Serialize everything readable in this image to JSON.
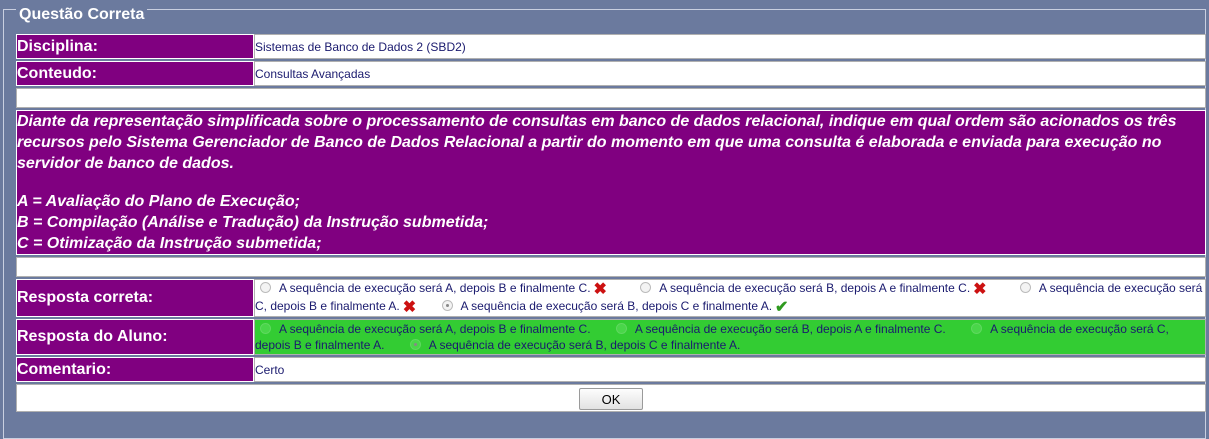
{
  "panel": {
    "title": "Questão Correta"
  },
  "disciplina": {
    "label": "Disciplina:",
    "value": "Sistemas de Banco de Dados 2 (SBD2)"
  },
  "conteudo": {
    "label": "Conteudo:",
    "value": "Consultas Avançadas"
  },
  "question": {
    "statement": "Diante da representação simplificada sobre o processamento de consultas em banco de dados relacional, indique em qual ordem são acionados os três recursos pelo Sistema Gerenciador de Banco de Dados Relacional a partir do momento em que uma consulta é elaborada e enviada para execução no servidor de banco de dados.",
    "items": [
      "A = Avaliação do Plano de Execução;",
      "B = Compilação (Análise e Tradução) da Instrução submetida;",
      "C = Otimização da Instrução submetida;"
    ]
  },
  "resposta_correta": {
    "label": "Resposta correta:",
    "options": [
      "A sequência de execução será A, depois B e finalmente C.",
      "A sequência de execução será B, depois A e finalmente C.",
      "A sequência de execução será C, depois B e finalmente A.",
      "A sequência de execução será B, depois C e finalmente A."
    ],
    "selected_index": 3,
    "icons": [
      "x-icon",
      "x-icon",
      "x-icon",
      "check-icon"
    ]
  },
  "resposta_aluno": {
    "label": "Resposta do Aluno:",
    "options": [
      "A sequência de execução será A, depois B e finalmente C.",
      "A sequência de execução será B, depois A e finalmente C.",
      "A sequência de execução será C, depois B e finalmente A.",
      "A sequência de execução será B, depois C e finalmente A."
    ],
    "selected_index": 3,
    "highlight_color": "#33cc33"
  },
  "comentario": {
    "label": "Comentario:",
    "value": "Certo"
  },
  "ok_button": {
    "label": "OK"
  },
  "colors": {
    "label_bg": "#800080",
    "page_bg": "#6b7a9e",
    "correct": "#33cc33",
    "wrong_icon": "#cc1111",
    "check_icon": "#2f9a1f"
  }
}
